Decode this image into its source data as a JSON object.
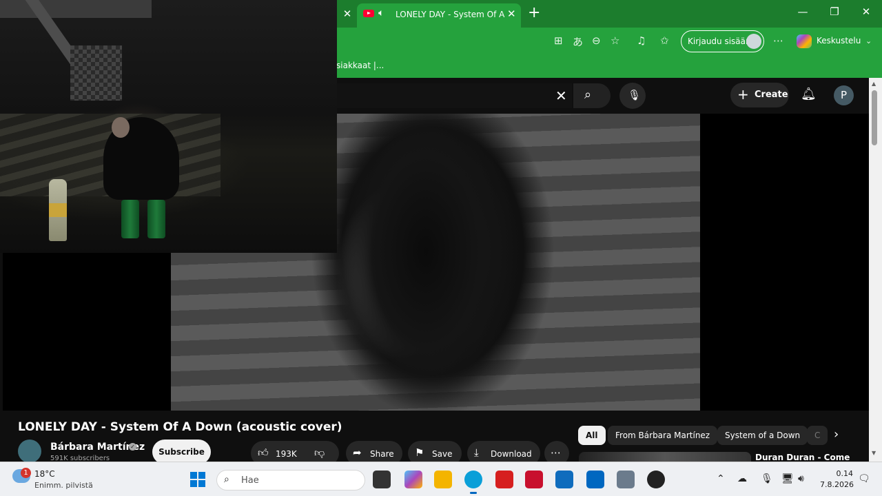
{
  "browser": {
    "active_tab_title": "LONELY DAY - System Of A Down",
    "signin_label": "Kirjaudu sisään",
    "copilot_label": "Keskustelu",
    "favorite_item": "siakkaat |..."
  },
  "youtube": {
    "create_label": "Create",
    "avatar_letter": "P",
    "video": {
      "title": "LONELY DAY - System Of A Down (acoustic cover)",
      "channel": "Bárbara Martínez",
      "subscribers": "591K subscribers",
      "subscribe_label": "Subscribe",
      "likes": "193K",
      "share_label": "Share",
      "save_label": "Save",
      "download_label": "Download"
    },
    "chips": [
      "All",
      "From Bárbara Martínez",
      "System of a Down",
      "C"
    ],
    "recommendation_title": "Duran Duran - Come"
  },
  "taskbar": {
    "temperature": "18°C",
    "weather_condition": "Enimm. pilvistä",
    "weather_badge": "1",
    "search_placeholder": "Hae",
    "time": "0.14",
    "date": "7.8.2026"
  }
}
